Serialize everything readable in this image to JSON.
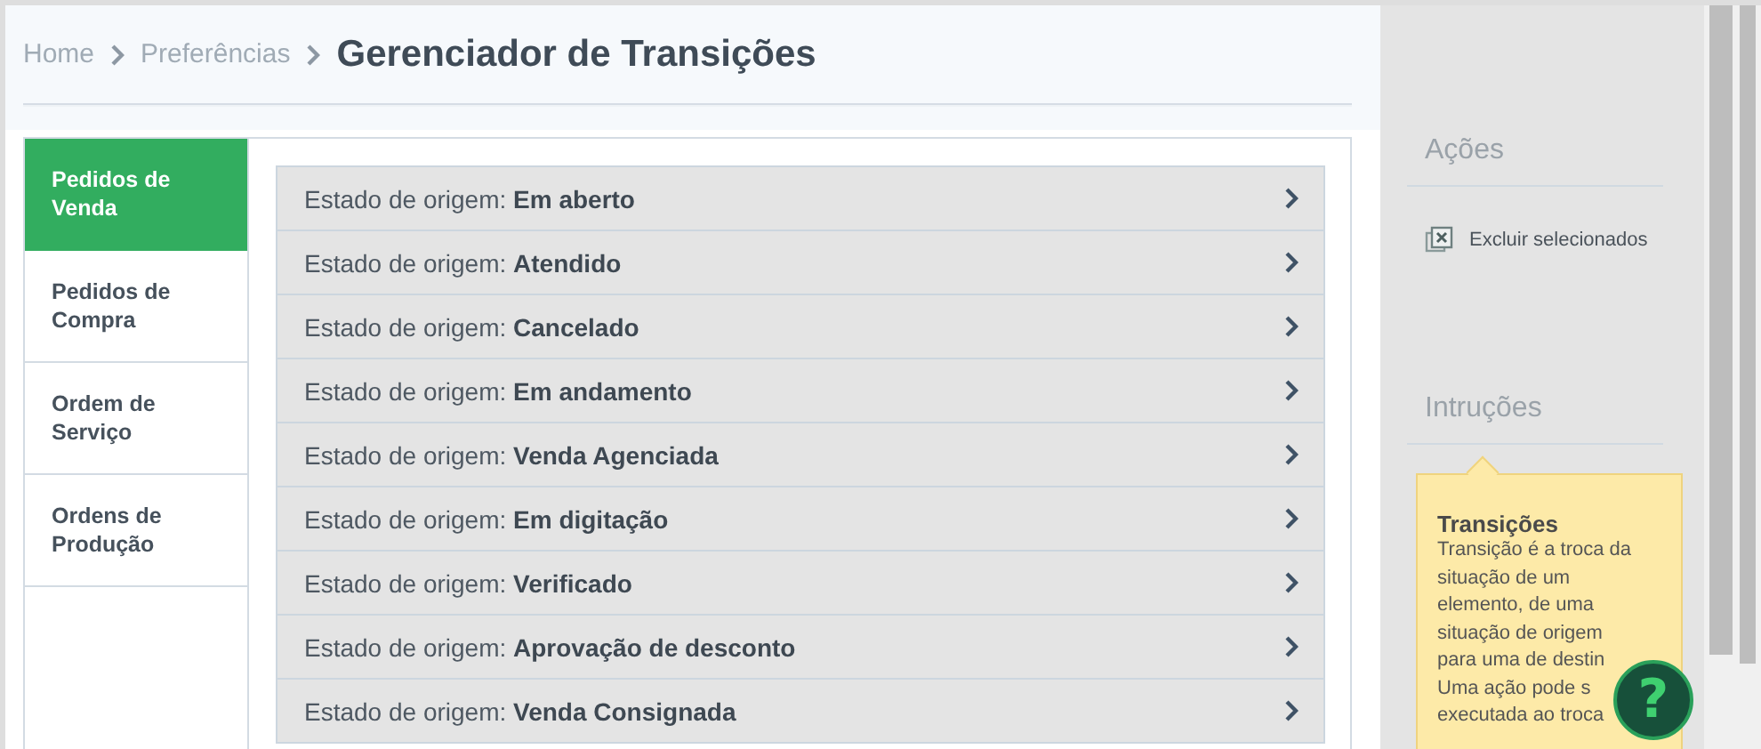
{
  "breadcrumb": {
    "links": [
      "Home",
      "Preferências"
    ],
    "title": "Gerenciador de Transições"
  },
  "tabs": [
    {
      "label": "Pedidos de Venda",
      "selected": true
    },
    {
      "label": "Pedidos de Compra",
      "selected": false
    },
    {
      "label": "Ordem de Serviço",
      "selected": false
    },
    {
      "label": "Ordens de Produção",
      "selected": false
    }
  ],
  "states": [
    {
      "prefix": "Estado de origem:",
      "value": "Em aberto"
    },
    {
      "prefix": "Estado de origem:",
      "value": "Atendido"
    },
    {
      "prefix": "Estado de origem:",
      "value": "Cancelado"
    },
    {
      "prefix": "Estado de origem:",
      "value": "Em andamento"
    },
    {
      "prefix": "Estado de origem:",
      "value": "Venda Agenciada"
    },
    {
      "prefix": "Estado de origem:",
      "value": "Em digitação"
    },
    {
      "prefix": "Estado de origem:",
      "value": "Verificado"
    },
    {
      "prefix": "Estado de origem:",
      "value": "Aprovação de desconto"
    },
    {
      "prefix": "Estado de origem:",
      "value": "Venda Consignada"
    }
  ],
  "sidebar": {
    "actions_title": "Ações",
    "actions": [
      {
        "label": "Excluir selecionados"
      }
    ],
    "instructions_title": "Intruções",
    "tooltip": {
      "title": "Transições",
      "lines": [
        "Transição é a troca da",
        "situação de um",
        "elemento, de uma",
        "situação de origem",
        "para uma de destin",
        "Uma ação pode s",
        "executada ao troca"
      ]
    },
    "help_button": "?"
  }
}
